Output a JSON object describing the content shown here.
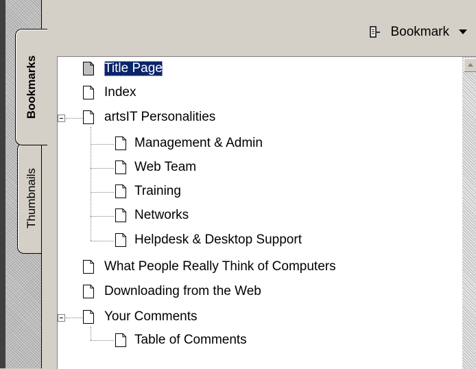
{
  "panel": {
    "tabs": [
      {
        "label": "Bookmarks",
        "active": true
      },
      {
        "label": "Thumbnails",
        "active": false
      }
    ],
    "menu_icon": "bookmark-options-icon",
    "menu_label": "Bookmark",
    "menu_arrow_icon": "dropdown-arrow-icon",
    "selection_color": "#0a246a"
  },
  "tree": [
    {
      "label": "Title Page",
      "selected": true
    },
    {
      "label": "Index"
    },
    {
      "label": "artsIT Personalities",
      "expanded": true
    },
    {
      "label": "Management & Admin"
    },
    {
      "label": "Web Team"
    },
    {
      "label": "Training"
    },
    {
      "label": "Networks"
    },
    {
      "label": "Helpdesk & Desktop Support"
    },
    {
      "label": "What People Really Think of Computers"
    },
    {
      "label": "Downloading from the Web"
    },
    {
      "label": "Your Comments",
      "expanded": true
    },
    {
      "label": "Table of Comments"
    }
  ]
}
